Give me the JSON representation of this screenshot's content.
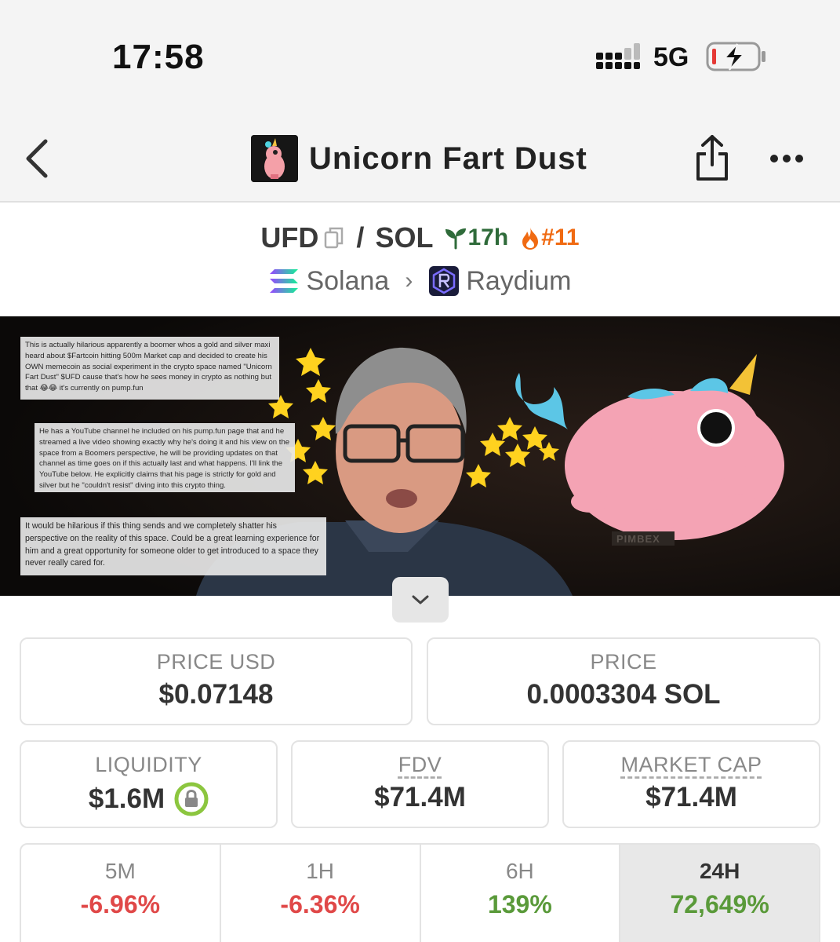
{
  "status_bar": {
    "time": "17:58",
    "network": "5G"
  },
  "nav": {
    "title": "Unicorn Fart Dust"
  },
  "pair": {
    "base": "UFD",
    "separator": "/",
    "quote": "SOL",
    "age": "17h",
    "rank": "#11",
    "chain": "Solana",
    "dex": "Raydium"
  },
  "banner": {
    "text_1": "This is actually hilarious apparently a boomer whos a gold and silver maxi heard about $Fartcoin hitting 500m Market cap and decided to create his OWN memecoin as social experiment in the crypto space named \"Unicorn Fart Dust\" $UFD cause that's how he sees money in crypto as nothing but that 😂😂 it's currently on pump.fun",
    "text_2": "He has a YouTube channel he included on his pump.fun page that and he streamed a live video showing exactly why he's doing it and his view on the space from a Boomers perspective, he will be providing updates on that channel as time goes on if this actually last and what happens. I'll link the YouTube below. He explicitly claims that his page is strictly for gold and silver but he \"couldn't resist\" diving into this crypto thing.",
    "text_3": "It would be hilarious if this thing sends and we completely shatter his perspective on the reality of this space. Could be a great learning experience for him and a great opportunity for someone older to get introduced to a space they never really cared for.",
    "sign": "PIMBEX"
  },
  "stats": {
    "price_usd_label": "PRICE USD",
    "price_usd": "$0.07148",
    "price_label": "PRICE",
    "price": "0.0003304 SOL",
    "liquidity_label": "LIQUIDITY",
    "liquidity": "$1.6M",
    "fdv_label": "FDV",
    "fdv": "$71.4M",
    "mcap_label": "MARKET CAP",
    "mcap": "$71.4M"
  },
  "changes": [
    {
      "label": "5M",
      "value": "-6.96%",
      "direction": "down"
    },
    {
      "label": "1H",
      "value": "-6.36%",
      "direction": "down"
    },
    {
      "label": "6H",
      "value": "139%",
      "direction": "up"
    },
    {
      "label": "24H",
      "value": "72,649%",
      "direction": "up",
      "selected": true
    }
  ],
  "colors": {
    "negative": "#e04848",
    "positive": "#5a9a3a",
    "rank": "#f06a12",
    "age": "#2f6b3a",
    "lock_ring": "#8cc63f"
  },
  "icons": [
    "back-arrow-icon",
    "share-icon",
    "more-icon",
    "copy-icon",
    "seedling-icon",
    "flame-icon",
    "solana-icon",
    "raydium-icon",
    "chevron-down-icon",
    "lock-icon",
    "signal-icon",
    "battery-charging-icon"
  ]
}
